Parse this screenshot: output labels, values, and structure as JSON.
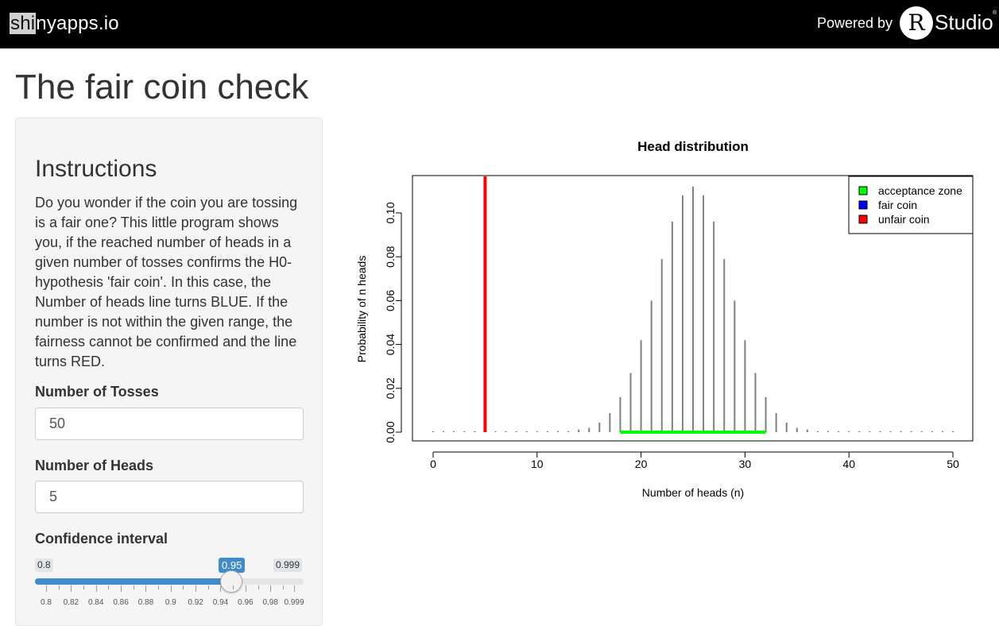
{
  "header": {
    "brand_hl": "shi",
    "brand_rest": "nyapps.io",
    "powered_by": "Powered by",
    "r_logo": "R",
    "studio": "Studio",
    "trademark": "®"
  },
  "page": {
    "title": "The fair coin check"
  },
  "sidebar": {
    "instructions_title": "Instructions",
    "instructions_text": "Do you wonder if the coin you are tossing is a fair one? This little program shows you, if the reached number of heads in a given number of tosses confirms the H0-hypothesis 'fair coin'. In this case, the Number of heads line turns BLUE. If the number is not within the given range, the fairness cannot be confirmed and the line turns RED.",
    "tosses_label": "Number of Tosses",
    "tosses_value": "50",
    "heads_label": "Number of Heads",
    "heads_value": "5",
    "confidence_label": "Confidence interval",
    "slider": {
      "min": 0.8,
      "max": 0.999,
      "value": 0.95,
      "min_label": "0.8",
      "max_label": "0.999",
      "value_label": "0.95",
      "tick_labels": [
        "0.8",
        "0.82",
        "0.84",
        "0.86",
        "0.88",
        "0.9",
        "0.92",
        "0.94",
        "0.96",
        "0.98",
        "0.999"
      ]
    }
  },
  "chart_data": {
    "type": "bar",
    "title": "Head distribution",
    "xlabel": "Number of heads (n)",
    "ylabel": "Probability of n heads",
    "xlim": [
      0,
      50
    ],
    "ylim": [
      0,
      0.12
    ],
    "x_ticks": [
      "0",
      "10",
      "20",
      "30",
      "40",
      "50"
    ],
    "y_ticks": [
      "0.00",
      "0.02",
      "0.04",
      "0.06",
      "0.08",
      "0.10"
    ],
    "n": 50,
    "x": [
      0,
      1,
      2,
      3,
      4,
      5,
      6,
      7,
      8,
      9,
      10,
      11,
      12,
      13,
      14,
      15,
      16,
      17,
      18,
      19,
      20,
      21,
      22,
      23,
      24,
      25,
      26,
      27,
      28,
      29,
      30,
      31,
      32,
      33,
      34,
      35,
      36,
      37,
      38,
      39,
      40,
      41,
      42,
      43,
      44,
      45,
      46,
      47,
      48,
      49,
      50
    ],
    "values": [
      0,
      0,
      0,
      0,
      0,
      0,
      0,
      0,
      0,
      0,
      0,
      0,
      0.0001,
      0.0003,
      0.0012,
      0.002,
      0.0044,
      0.0087,
      0.016,
      0.027,
      0.042,
      0.06,
      0.079,
      0.096,
      0.108,
      0.112,
      0.108,
      0.096,
      0.079,
      0.06,
      0.042,
      0.027,
      0.016,
      0.0087,
      0.0044,
      0.002,
      0.0012,
      0.0003,
      0.0001,
      0,
      0,
      0,
      0,
      0,
      0,
      0,
      0,
      0,
      0,
      0,
      0
    ],
    "acceptance_zone": [
      18,
      32
    ],
    "observed_heads": 5,
    "legend": {
      "placement": "top-right",
      "items": [
        {
          "label": "acceptance zone",
          "color": "#00ff00"
        },
        {
          "label": "fair coin",
          "color": "#0000ff"
        },
        {
          "label": "unfair coin",
          "color": "#ff0000"
        }
      ]
    },
    "colors": {
      "bars": "#808080",
      "acceptance": "#00ff00",
      "observed": "#ff0000"
    }
  }
}
